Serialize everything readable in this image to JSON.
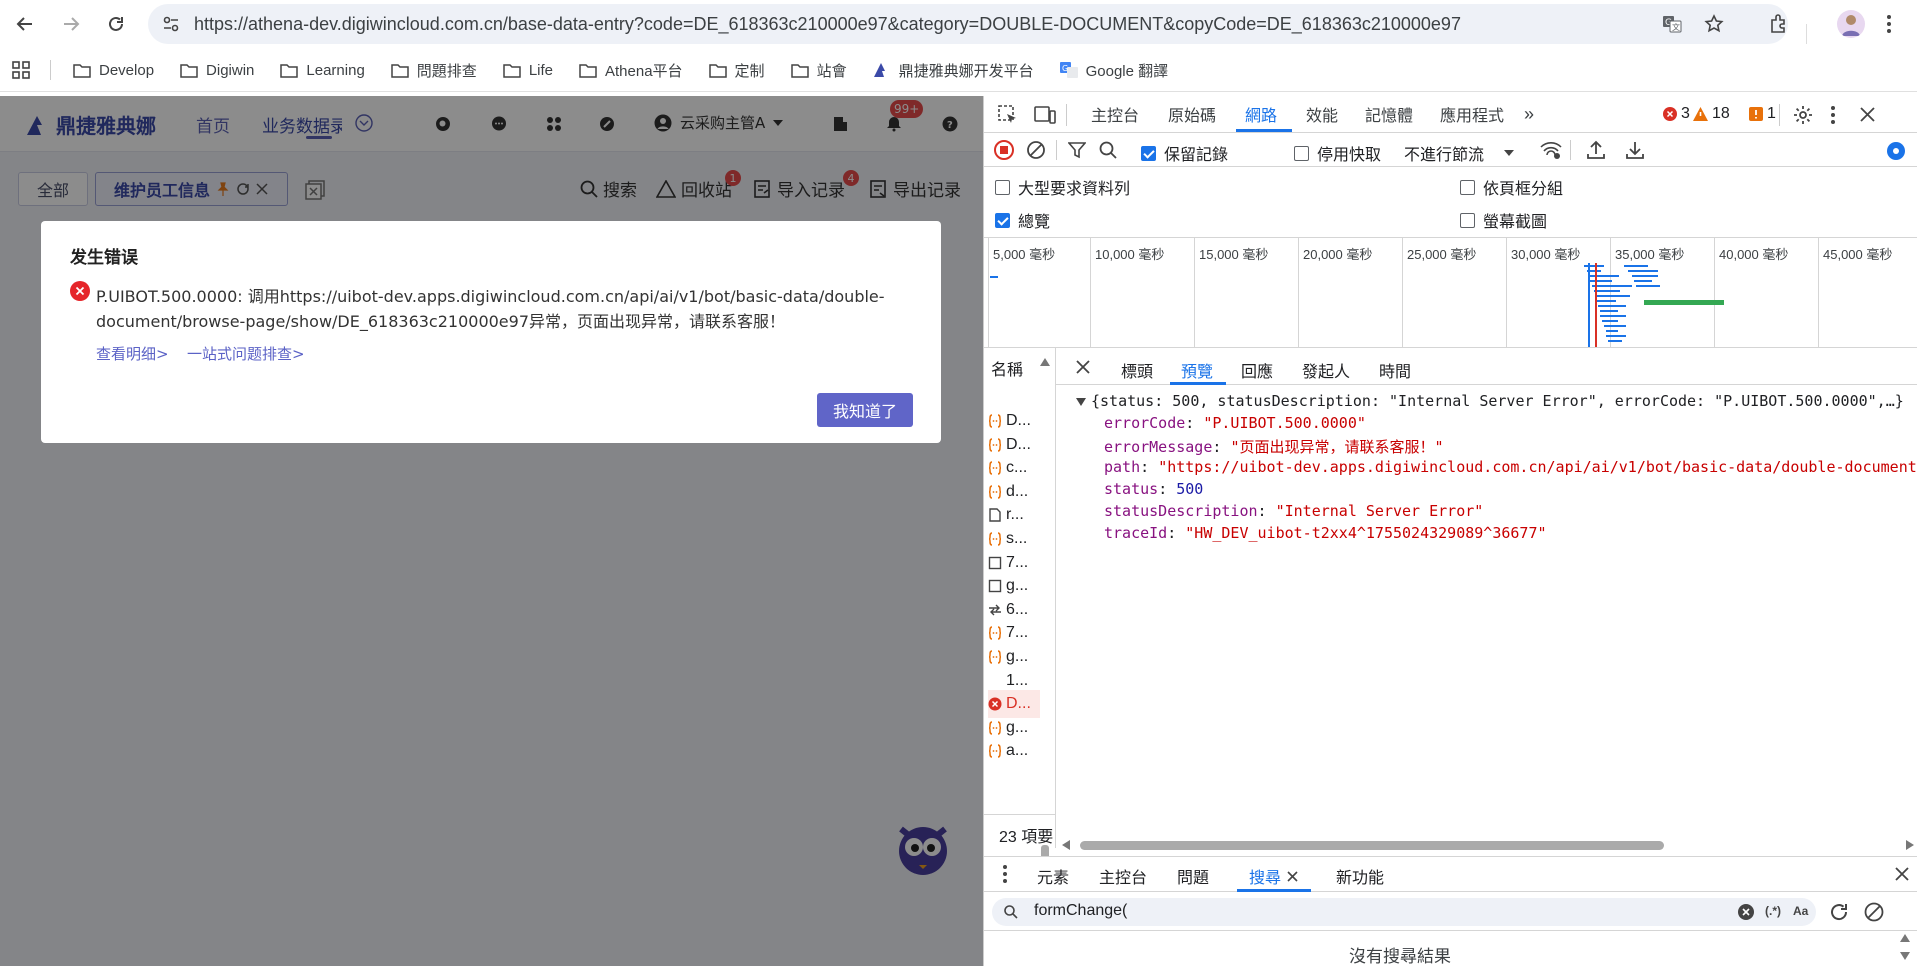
{
  "browser": {
    "url": "https://athena-dev.digiwincloud.com.cn/base-data-entry?code=DE_618363c210000e97&category=DOUBLE-DOCUMENT&copyCode=DE_618363c210000e97",
    "bookmarks": [
      "Develop",
      "Digiwin",
      "Learning",
      "問題排查",
      "Life",
      "Athena平台",
      "定制",
      "站會",
      "鼎捷雅典娜开发平台",
      "Google 翻譯"
    ]
  },
  "app": {
    "logo_text": "鼎捷雅典娜",
    "nav": [
      "首页",
      "业务数据录"
    ],
    "user_name": "云采购主管A",
    "notif_badge": "99+",
    "tab_all": "全部",
    "tab_active": "维护员工信息",
    "tools": [
      {
        "label": "搜索",
        "badge": ""
      },
      {
        "label": "回收站",
        "badge": "1"
      },
      {
        "label": "导入记录",
        "badge": "4"
      },
      {
        "label": "导出记录",
        "badge": ""
      }
    ]
  },
  "modal": {
    "title": "发生错误",
    "message_line1": "P.UIBOT.500.0000: 调用https://uibot-dev.apps.digiwincloud.com.cn/api/ai/v1/bot/basic-data/double-",
    "message_line2": "document/browse-page/show/DE_618363c210000e97异常，页面出现异常，请联系客服！",
    "link_detail": "查看明细>",
    "link_troubleshoot": "一站式问题排查>",
    "ok_button": "我知道了"
  },
  "devtools": {
    "tabs": [
      "主控台",
      "原始碼",
      "網路",
      "效能",
      "記憶體",
      "應用程式"
    ],
    "active_tab": "網路",
    "errors": "3",
    "warnings": "18",
    "issues": "1",
    "preserve_log": "保留記錄",
    "disable_cache": "停用快取",
    "throttle": "不進行節流",
    "opt_large_rows": "大型要求資料列",
    "opt_group_frame": "依頁框分組",
    "opt_overview": "總覽",
    "opt_screenshots": "螢幕截圖",
    "timeline_ticks": [
      "5,000 毫秒",
      "10,000 毫秒",
      "15,000 毫秒",
      "20,000 毫秒",
      "25,000 毫秒",
      "30,000 毫秒",
      "35,000 毫秒",
      "40,000 毫秒",
      "45,000 毫秒"
    ],
    "name_header": "名稱",
    "requests": [
      {
        "icon": "json",
        "name": "D..."
      },
      {
        "icon": "json",
        "name": "D..."
      },
      {
        "icon": "json",
        "name": "c..."
      },
      {
        "icon": "json",
        "name": "d..."
      },
      {
        "icon": "doc",
        "name": "r..."
      },
      {
        "icon": "json",
        "name": "s..."
      },
      {
        "icon": "box",
        "name": "7..."
      },
      {
        "icon": "box",
        "name": "g..."
      },
      {
        "icon": "ws",
        "name": "6..."
      },
      {
        "icon": "json",
        "name": "7..."
      },
      {
        "icon": "json",
        "name": "g..."
      },
      {
        "icon": "none",
        "name": "1..."
      },
      {
        "icon": "err",
        "name": "D..."
      },
      {
        "icon": "json",
        "name": "g..."
      },
      {
        "icon": "json",
        "name": "a..."
      }
    ],
    "item_count": "23 項要",
    "detail_tabs": [
      "標頭",
      "預覽",
      "回應",
      "發起人",
      "時間"
    ],
    "active_detail_tab": "預覽",
    "preview_summary": "{status: 500, statusDescription: \"Internal Server Error\", errorCode: \"P.UIBOT.500.0000\",…}",
    "preview_fields": [
      {
        "key": "errorCode",
        "value": "\"P.UIBOT.500.0000\"",
        "type": "string"
      },
      {
        "key": "errorMessage",
        "value": "\"页面出现异常，请联系客服！\"",
        "type": "string"
      },
      {
        "key": "path",
        "value": "\"https://uibot-dev.apps.digiwincloud.com.cn/api/ai/v1/bot/basic-data/double-document",
        "type": "string"
      },
      {
        "key": "status",
        "value": "500",
        "type": "number"
      },
      {
        "key": "statusDescription",
        "value": "\"Internal Server Error\"",
        "type": "string"
      },
      {
        "key": "traceId",
        "value": "\"HW_DEV_uibot-t2xx4^1755024329089^36677\"",
        "type": "string"
      }
    ],
    "drawer_tabs": [
      "元素",
      "主控台",
      "問題",
      "搜尋",
      "新功能"
    ],
    "active_drawer_tab": "搜尋",
    "search_value": "formChange(",
    "search_opt_regex": "(.*)",
    "search_opt_case": "Aa",
    "no_results": "沒有搜尋結果"
  }
}
